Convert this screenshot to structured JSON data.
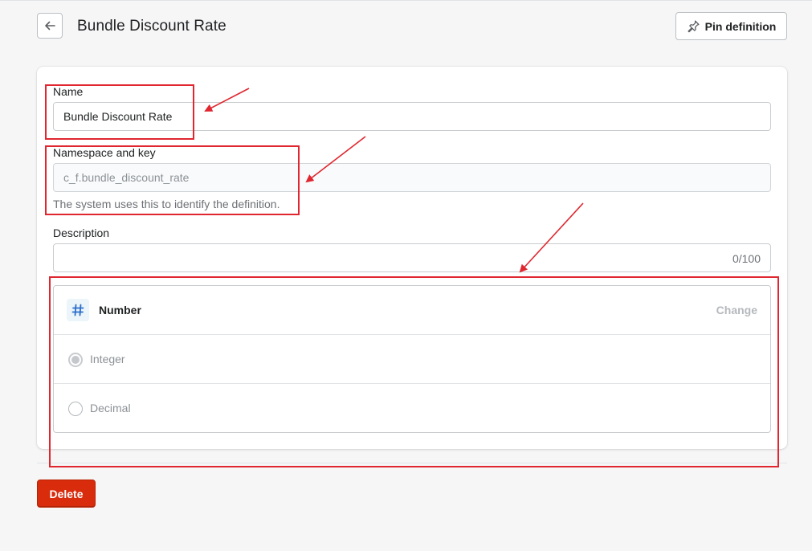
{
  "header": {
    "title": "Bundle Discount Rate",
    "pin_label": "Pin definition"
  },
  "form": {
    "name_label": "Name",
    "name_value": "Bundle Discount Rate",
    "namespace_label": "Namespace and key",
    "namespace_value": "c_f.bundle_discount_rate",
    "namespace_help": "The system uses this to identify the definition.",
    "description_label": "Description",
    "description_value": "",
    "description_counter": "0/100"
  },
  "type_selector": {
    "type_name": "Number",
    "change_label": "Change",
    "options": [
      {
        "label": "Integer",
        "checked": true
      },
      {
        "label": "Decimal",
        "checked": false
      }
    ]
  },
  "footer": {
    "delete_label": "Delete"
  },
  "colors": {
    "annotation": "#e0262f",
    "delete": "#d82c0d",
    "type_icon": "#2c6ecb"
  },
  "icons": [
    "arrow-left-icon",
    "pin-icon",
    "hash-icon"
  ]
}
